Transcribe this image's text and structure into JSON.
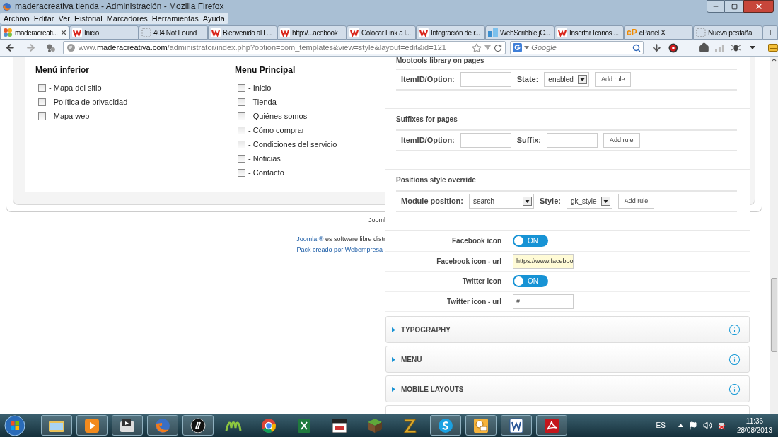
{
  "window": {
    "title": "maderacreativa tienda - Administración - Mozilla Firefox"
  },
  "menu_bar": [
    "Archivo",
    "Editar",
    "Ver",
    "Historial",
    "Marcadores",
    "Herramientas",
    "Ayuda"
  ],
  "tabs": [
    {
      "label": "maderacreati...",
      "kind": "joomla",
      "selected": true,
      "closable": true
    },
    {
      "label": "Inicio",
      "kind": "w",
      "selected": false,
      "closable": false
    },
    {
      "label": "404 Not Found",
      "kind": "blank",
      "selected": false,
      "closable": false
    },
    {
      "label": "Bienvenido al F...",
      "kind": "w",
      "selected": false,
      "closable": false
    },
    {
      "label": "http://...acebook",
      "kind": "w",
      "selected": false,
      "closable": false
    },
    {
      "label": "Colocar Link a l...",
      "kind": "w",
      "selected": false,
      "closable": false
    },
    {
      "label": "Integración de r...",
      "kind": "w",
      "selected": false,
      "closable": false
    },
    {
      "label": "WebScribble jC...",
      "kind": "blocks",
      "selected": false,
      "closable": false
    },
    {
      "label": "Insertar Iconos ...",
      "kind": "w",
      "selected": false,
      "closable": false
    },
    {
      "label": "cPanel X",
      "kind": "badge",
      "badge": "cP",
      "selected": false,
      "closable": false
    },
    {
      "label": "Nueva pestaña",
      "kind": "blank",
      "selected": false,
      "closable": false
    }
  ],
  "new_tab": "+",
  "address_bar": {
    "url": "www.**maderacreativa.com**/administrator/index.php?option=com_templates&view=style&layout=edit&id=121"
  },
  "search": {
    "placeholder": "Google"
  },
  "page": {
    "menus": [
      {
        "title": "Menú inferior",
        "items": [
          {
            "label": "- Mapa del sitio",
            "checked": false
          },
          {
            "label": "- Política de privacidad",
            "checked": false
          },
          {
            "label": "- Mapa web",
            "checked": false
          }
        ]
      },
      {
        "title": "Menu Principal",
        "items": [
          {
            "label": "- Inicio",
            "checked": false
          },
          {
            "label": "- Tienda",
            "checked": false
          },
          {
            "label": "- Quiénes somos",
            "checked": false
          },
          {
            "label": "- Cómo comprar",
            "checked": false
          },
          {
            "label": "- Condiciones del servicio",
            "checked": false
          },
          {
            "label": "- Noticias",
            "checked": false
          },
          {
            "label": "- Contacto",
            "checked": false
          }
        ]
      }
    ],
    "footer": {
      "version": "Jooml",
      "credit_link": "Joomla!®",
      "credit_text": "es software libre distr",
      "pack": "Pack creado por Webempresa"
    }
  },
  "settings": {
    "rule_sections": [
      {
        "title": "Mootools library on pages",
        "fields": [
          {
            "kind": "input",
            "label": "ItemID/Option:"
          },
          {
            "kind": "select",
            "label": "State:",
            "value": "enabled"
          }
        ],
        "button": "Add rule"
      },
      {
        "title": "Suffixes for pages",
        "fields": [
          {
            "kind": "input",
            "label": "ItemID/Option:"
          },
          {
            "kind": "input",
            "label": "Suffix:"
          }
        ],
        "button": "Add rule"
      },
      {
        "title": "Positions style override",
        "fields": [
          {
            "kind": "select",
            "label": "Module position:",
            "value": "search"
          },
          {
            "kind": "select",
            "label": "Style:",
            "value": "gk_style"
          }
        ],
        "button": "Add rule"
      }
    ],
    "rows": [
      {
        "kind": "toggle",
        "label": "Facebook icon",
        "on": true,
        "text": "ON"
      },
      {
        "kind": "text",
        "label": "Facebook icon - url",
        "value": "https://www.faceboo",
        "autofilled": true
      },
      {
        "kind": "toggle",
        "label": "Twitter icon",
        "on": true,
        "text": "ON"
      },
      {
        "kind": "text",
        "label": "Twitter icon - url",
        "value": "#",
        "autofilled": false
      }
    ],
    "accordions": [
      {
        "title": "TYPOGRAPHY",
        "expanded": false
      },
      {
        "title": "MENU",
        "expanded": false
      },
      {
        "title": "MOBILE LAYOUTS",
        "expanded": false
      }
    ]
  },
  "taskbar": {
    "apps": [
      {
        "kind": "folder",
        "running": true
      },
      {
        "kind": "media",
        "running": true
      },
      {
        "kind": "film",
        "running": true
      },
      {
        "kind": "firefox",
        "running": true
      },
      {
        "kind": "hp",
        "running": true
      },
      {
        "kind": "movistar",
        "running": false
      },
      {
        "kind": "chrome",
        "running": false
      },
      {
        "kind": "excel",
        "running": false
      },
      {
        "kind": "clapper",
        "running": false
      },
      {
        "kind": "cube",
        "running": false
      },
      {
        "kind": "zlogo",
        "running": false
      },
      {
        "kind": "skype",
        "running": true
      },
      {
        "kind": "outlook",
        "running": true
      },
      {
        "kind": "word",
        "running": true
      },
      {
        "kind": "pdf",
        "running": true
      }
    ],
    "language": "ES",
    "time": "11:36",
    "date": "28/08/2013"
  }
}
